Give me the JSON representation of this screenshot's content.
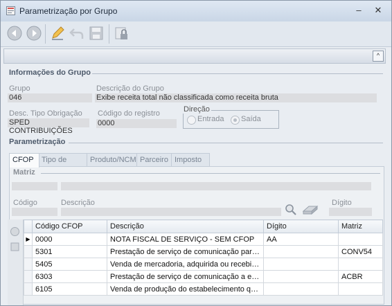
{
  "window": {
    "title": "Parametrização por Grupo"
  },
  "colors": {
    "accent": "#4d5a6b",
    "titlebar": "#c9d6e6"
  },
  "toolbar": {
    "icons": [
      "back-icon",
      "forward-icon",
      "edit-icon",
      "undo-icon",
      "save-icon",
      "lock-icon"
    ]
  },
  "grupo_section": {
    "title": "Informações do Grupo",
    "grupo_label": "Grupo",
    "grupo_value": "046",
    "descricao_label": "Descrição do Grupo",
    "descricao_value": "Exibe receita total não classificada como receita bruta",
    "tipo_obrigacao_label": "Desc. Tipo Obrigação",
    "tipo_obrigacao_value": "SPED CONTRIBUIÇÕES",
    "codigo_registro_label": "Código do registro",
    "codigo_registro_value": "0000",
    "direcao_label": "Direção",
    "entrada_label": "Entrada",
    "saida_label": "Saída",
    "direcao_selected": "Saída"
  },
  "param_section": {
    "title": "Parametrização",
    "tabs": [
      "CFOP",
      "Tipo de Nota",
      "Produto/NCM",
      "Parceiro",
      "Imposto"
    ],
    "active_tab": "CFOP",
    "matriz_label": "Matriz",
    "codigo_label": "Código",
    "descricao_label": "Descrição",
    "digito_label": "Dígito"
  },
  "grid": {
    "columns": [
      "Código CFOP",
      "Descrição",
      "Dígito",
      "Matriz"
    ],
    "rows": [
      {
        "codigo": "0000",
        "descricao": "NOTA FISCAL DE SERVIÇO - SEM CFOP",
        "digito": "AA",
        "matriz": ""
      },
      {
        "codigo": "5301",
        "descricao": "Prestação de serviço de comunicação para exec...",
        "digito": "",
        "matriz": "CONV54"
      },
      {
        "codigo": "5405",
        "descricao": "Venda de mercadoria, adquirida ou recebida de ...",
        "digito": "",
        "matriz": ""
      },
      {
        "codigo": "6303",
        "descricao": "Prestação de serviço de comunicação a estabel...",
        "digito": "",
        "matriz": "ACBR"
      },
      {
        "codigo": "6105",
        "descricao": "Venda de produção do estabelecimento que nã...",
        "digito": "",
        "matriz": ""
      }
    ]
  }
}
